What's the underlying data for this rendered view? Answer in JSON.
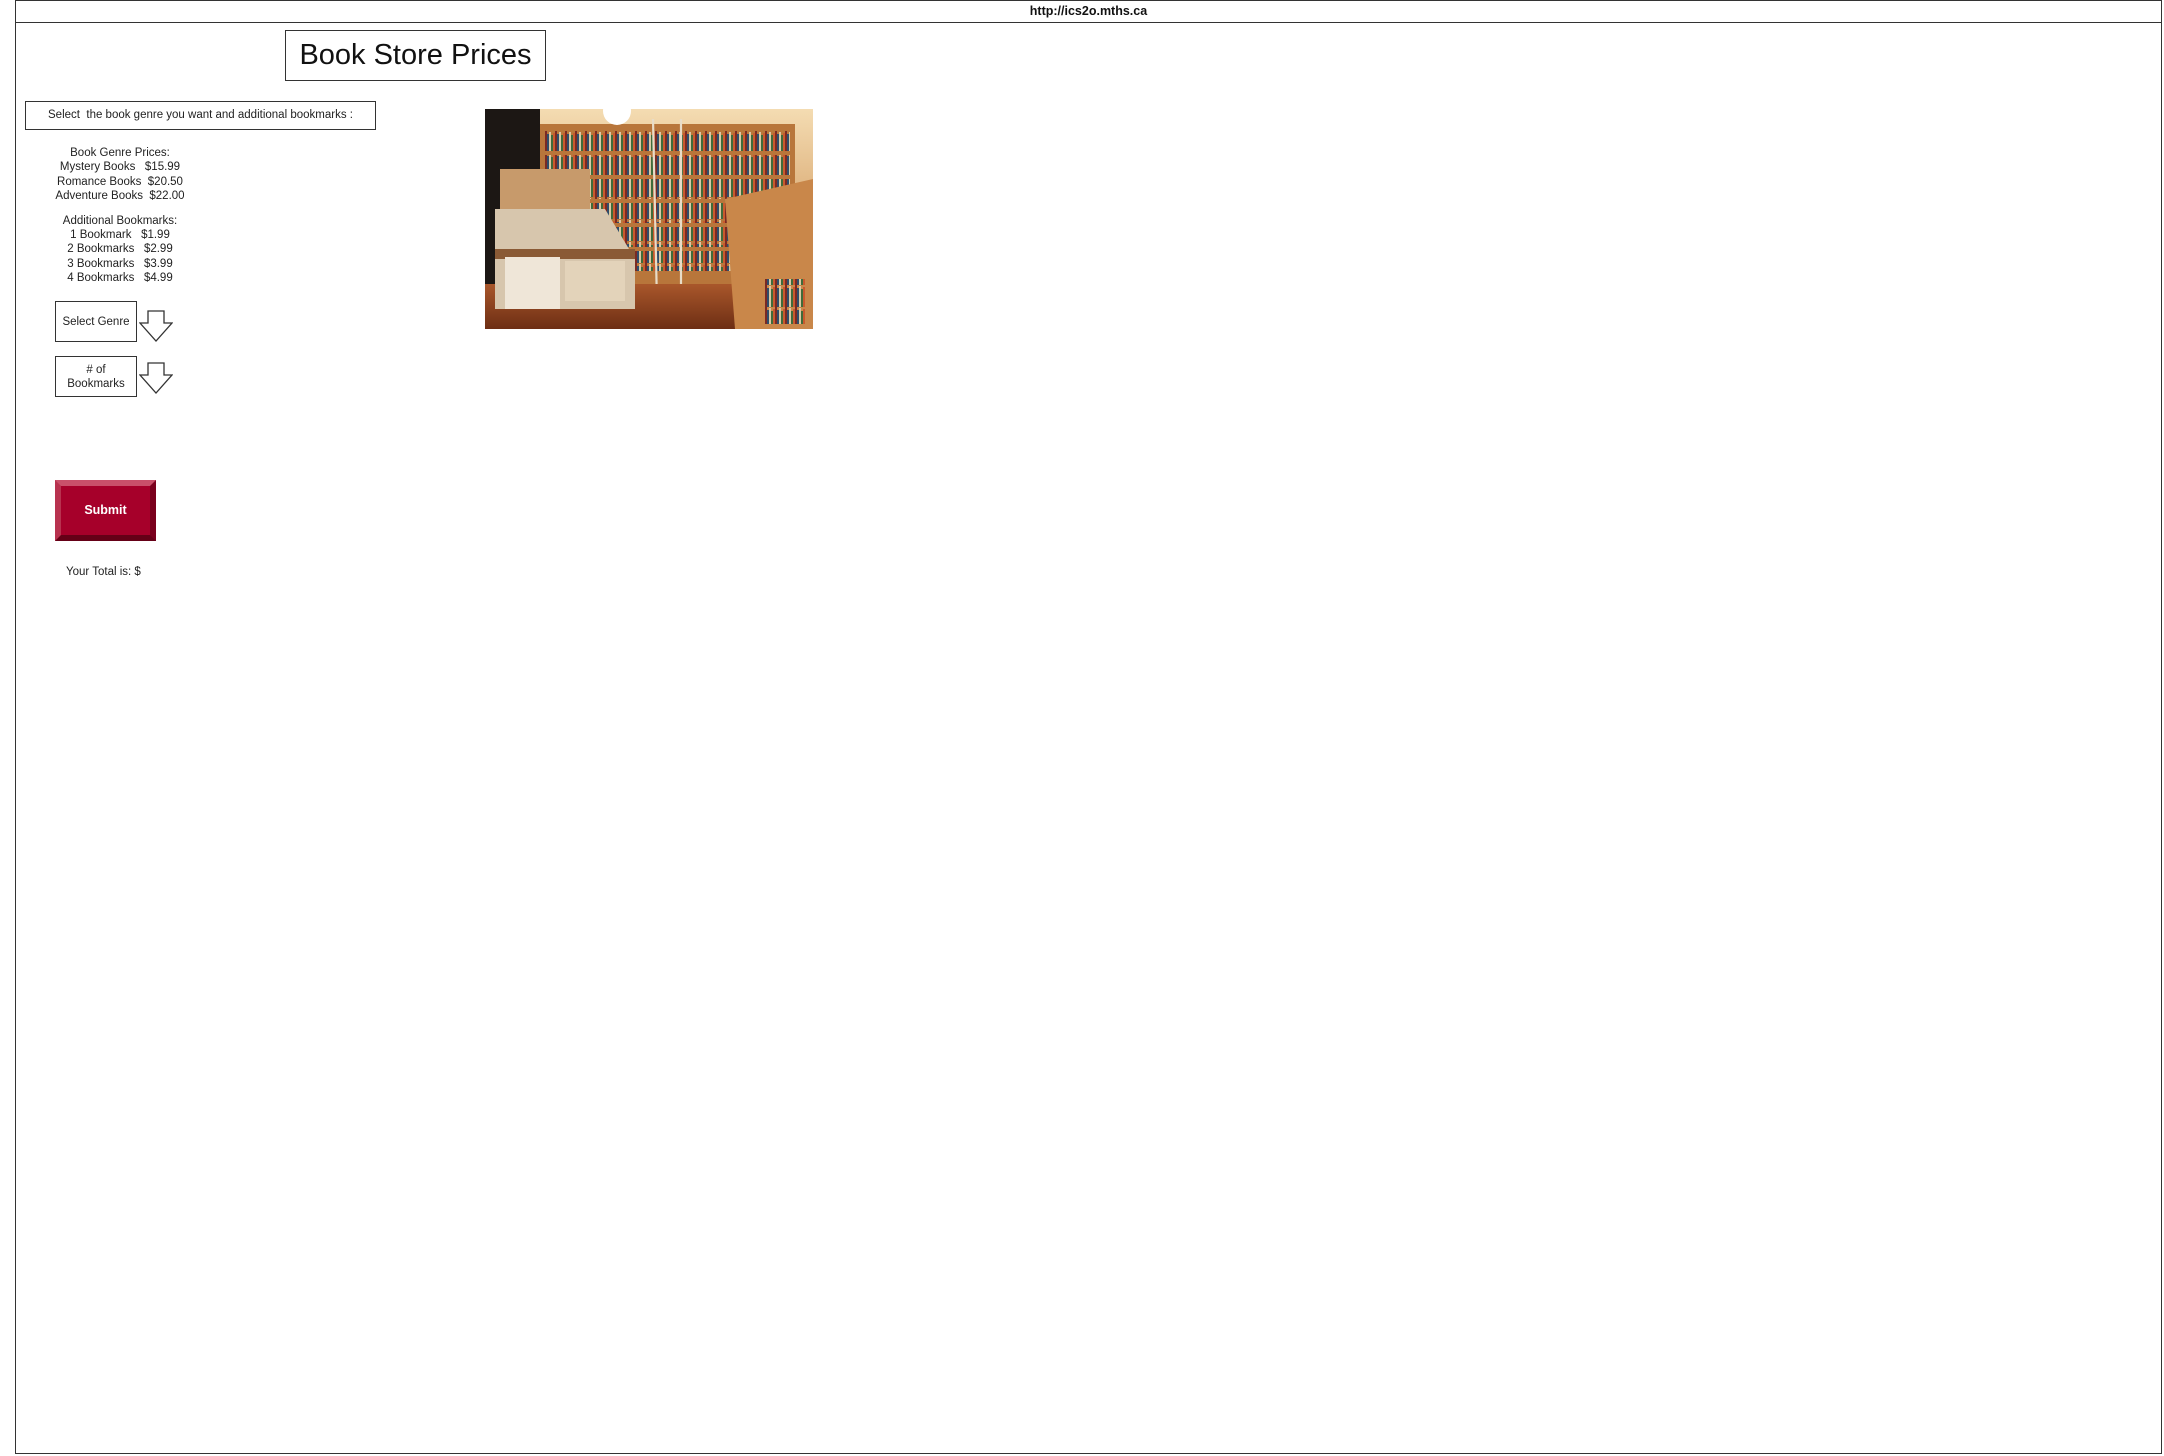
{
  "url": "http://ics2o.mths.ca",
  "page": {
    "title": "Book Store Prices",
    "instruction": "Select  the book genre you want and additional bookmarks :"
  },
  "prices": {
    "genre_heading": "Book Genre Prices:",
    "genres": [
      "Mystery Books   $15.99",
      "Romance Books  $20.50",
      "Adventure Books  $22.00"
    ],
    "bookmarks_heading": "Additional Bookmarks:",
    "bookmarks": [
      "1 Bookmark   $1.99",
      "2 Bookmarks   $2.99",
      "3 Bookmarks   $3.99",
      "4 Bookmarks   $4.99"
    ]
  },
  "controls": {
    "genre_select_label": "Select Genre",
    "bookmark_select_label_line1": "# of",
    "bookmark_select_label_line2": "Bookmarks",
    "submit_label": "Submit"
  },
  "output": {
    "total_label": "Your Total is: $"
  },
  "icons": {
    "dropdown": "arrow-down-icon"
  },
  "colors": {
    "submit_background": "#a6002a",
    "border": "#333333"
  }
}
